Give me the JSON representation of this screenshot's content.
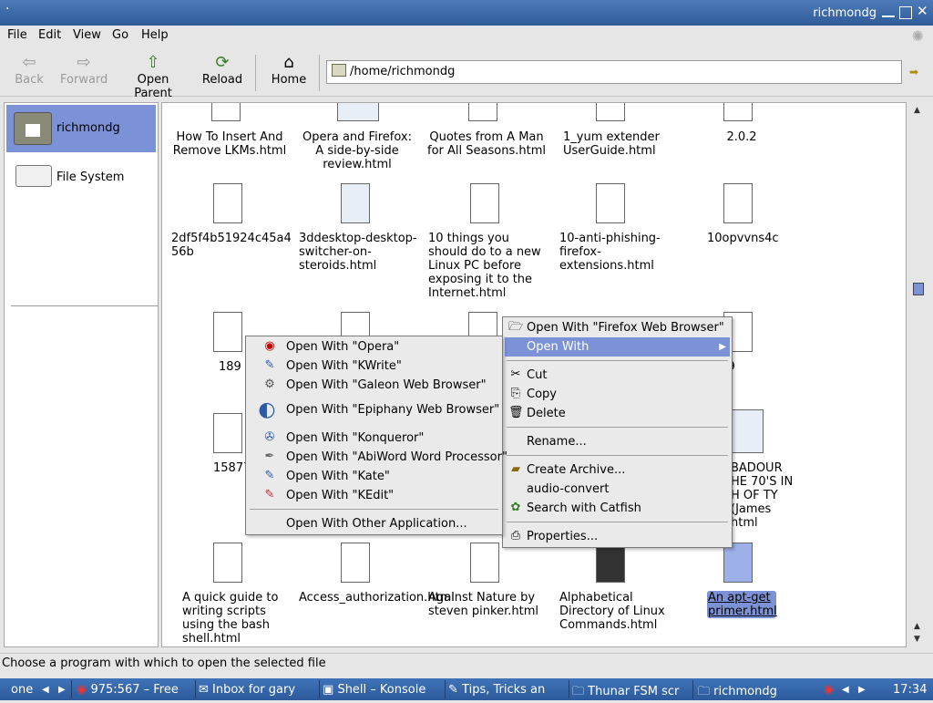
{
  "window": {
    "title": "richmondg",
    "dot": "·"
  },
  "menubar": {
    "file": "File",
    "edit": "Edit",
    "view": "View",
    "go": "Go",
    "help": "Help"
  },
  "toolbar": {
    "back": "Back",
    "forward": "Forward",
    "open_parent": "Open Parent",
    "reload": "Reload",
    "home": "Home"
  },
  "location": {
    "path": "/home/richmondg"
  },
  "sidebar": {
    "items": [
      {
        "label": "richmondg"
      },
      {
        "label": "File System"
      }
    ]
  },
  "files": [
    {
      "name": "How To Insert And Remove LKMs.html"
    },
    {
      "name": "Opera and Firefox: A side-by-side review.html"
    },
    {
      "name": "Quotes from A Man for All Seasons.html"
    },
    {
      "name": "1_yum extender UserGuide.html"
    },
    {
      "name": "2.0.2"
    },
    {
      "name": "2df5f4b51924c45a4 56b"
    },
    {
      "name": "3ddesktop-desktop-switcher-on-steroids.html"
    },
    {
      "name": "10 things you should do to a new Linux PC before exposing it to the Internet.html"
    },
    {
      "name": "10-anti-phishing-firefox-extensions.html"
    },
    {
      "name": "10opvvns4c"
    },
    {
      "name": "189"
    },
    {
      "name": "999"
    },
    {
      "name": "15877"
    },
    {
      "name": "BADOUR HE 70'S IN H OF TY (James html"
    },
    {
      "name": "A quick guide to writing scripts using the bash shell.html"
    },
    {
      "name": "Access_authorization.html"
    },
    {
      "name": "Against Nature by steven pinker.html"
    },
    {
      "name": "Alphabetical Directory of Linux Commands.html"
    },
    {
      "name": "An apt-get primer.html"
    }
  ],
  "context_menu": {
    "items": [
      {
        "label": "Open With \"Firefox Web Browser\""
      },
      {
        "label": "Open With"
      },
      {
        "label": "Cut"
      },
      {
        "label": "Copy"
      },
      {
        "label": "Delete"
      },
      {
        "label": "Rename..."
      },
      {
        "label": "Create Archive..."
      },
      {
        "label": "audio-convert"
      },
      {
        "label": "Search with Catfish"
      },
      {
        "label": "Properties..."
      }
    ]
  },
  "submenu": {
    "items": [
      {
        "label": "Open With \"Opera\""
      },
      {
        "label": "Open With \"KWrite\""
      },
      {
        "label": "Open With \"Galeon Web Browser\""
      },
      {
        "label": "Open With \"Epiphany Web Browser\""
      },
      {
        "label": "Open With \"Konqueror\""
      },
      {
        "label": "Open With \"AbiWord Word Processor\""
      },
      {
        "label": "Open With \"Kate\""
      },
      {
        "label": "Open With \"KEdit\""
      },
      {
        "label": "Open With Other Application..."
      }
    ]
  },
  "statusbar": {
    "text": "Choose a program with which to open the selected file"
  },
  "taskbar": {
    "desk": "one",
    "tasks": [
      {
        "label": "975:567 – Free"
      },
      {
        "label": "Inbox for gary"
      },
      {
        "label": "Shell – Konsole"
      },
      {
        "label": "Tips, Tricks an"
      },
      {
        "label": "Thunar FSM scr"
      },
      {
        "label": "richmondg"
      }
    ],
    "clock": "17:34"
  },
  "colors": {
    "selection": "#7b93d6",
    "titlebar": "#3a6aa8",
    "taskbar": "#3564a8"
  }
}
